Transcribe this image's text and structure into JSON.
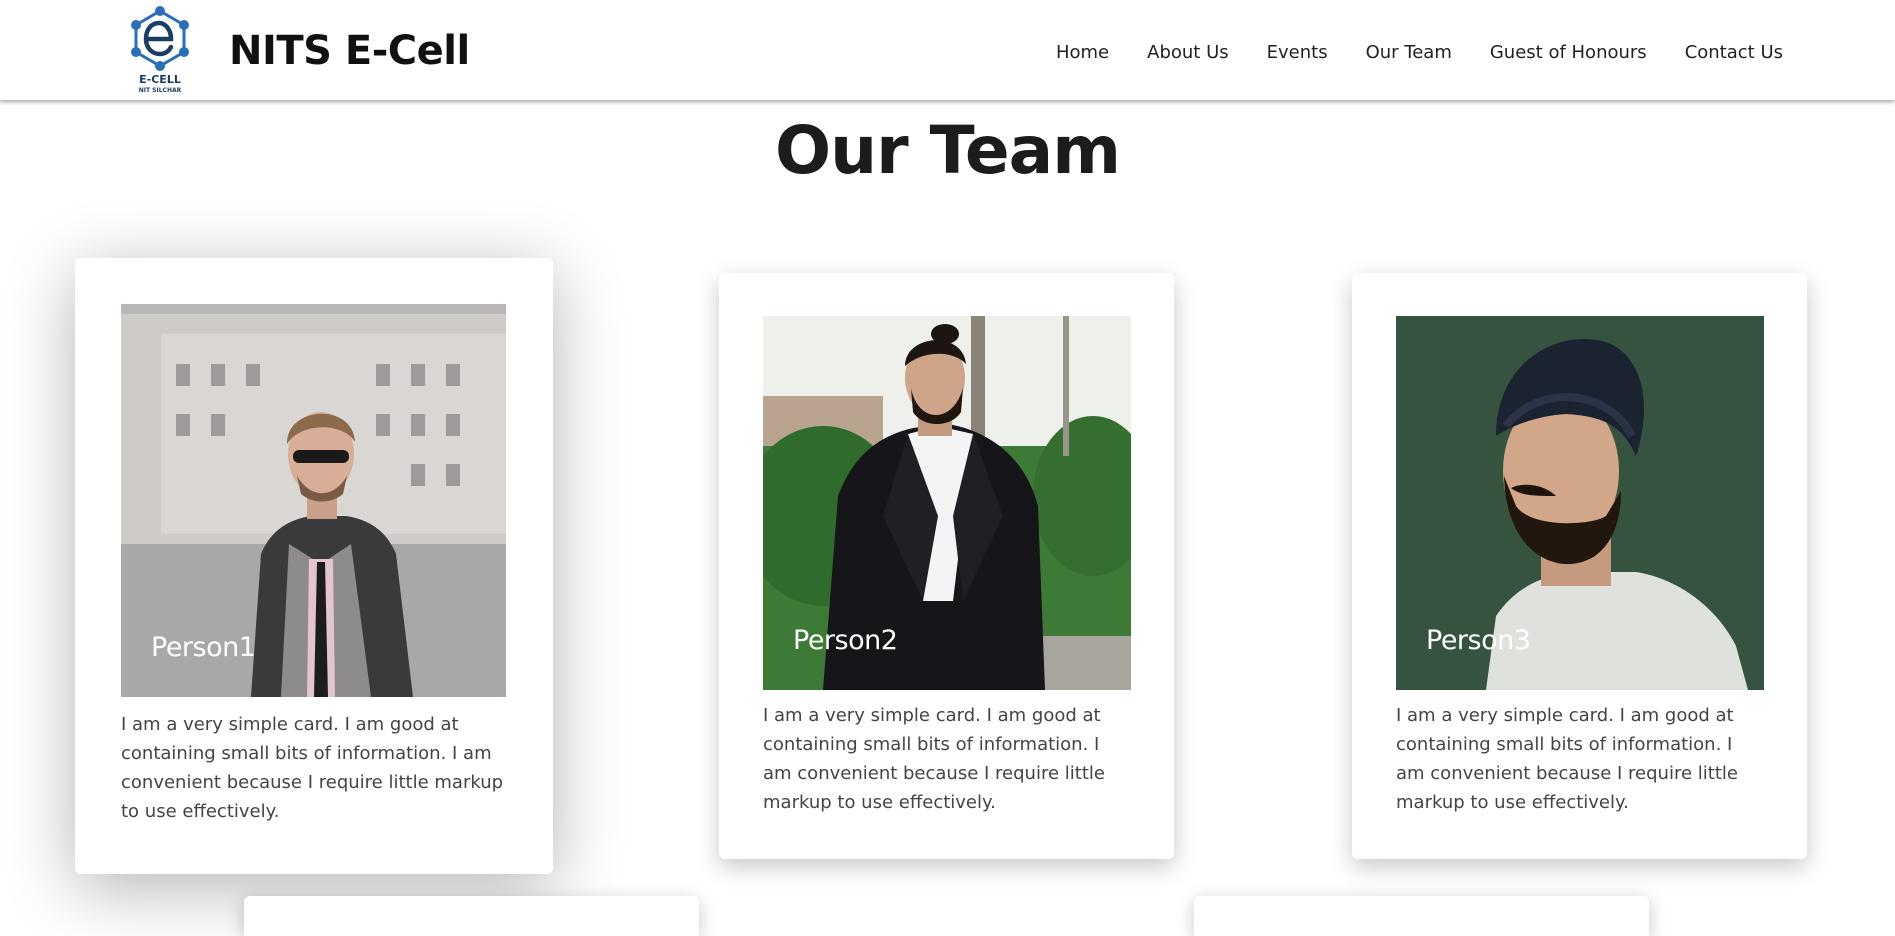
{
  "navbar": {
    "logo_text_main": "E-CELL",
    "logo_text_sub": "NIT SILCHAR",
    "brand_title": "NITS E-Cell",
    "links": [
      {
        "label": "Home"
      },
      {
        "label": "About Us"
      },
      {
        "label": "Events"
      },
      {
        "label": "Our Team"
      },
      {
        "label": "Guest of Honours"
      },
      {
        "label": "Contact Us"
      }
    ]
  },
  "team": {
    "heading": "Our Team",
    "cards": [
      {
        "name": "Person1",
        "description": "I am a very simple card. I am good at containing small bits of information. I am convenient because I require little markup to use effectively."
      },
      {
        "name": "Person2",
        "description": "I am a very simple card. I am good at containing small bits of information. I am convenient because I require little markup to use effectively."
      },
      {
        "name": "Person3",
        "description": "I am a very simple card. I am good at containing small bits of information. I am convenient because I require little markup to use effectively."
      }
    ]
  },
  "colors": {
    "background": "#ffffff",
    "logo_blue": "#2a6fb5",
    "logo_dark": "#1c3d63",
    "heading": "#1c1c1c",
    "body_text": "#444444"
  }
}
